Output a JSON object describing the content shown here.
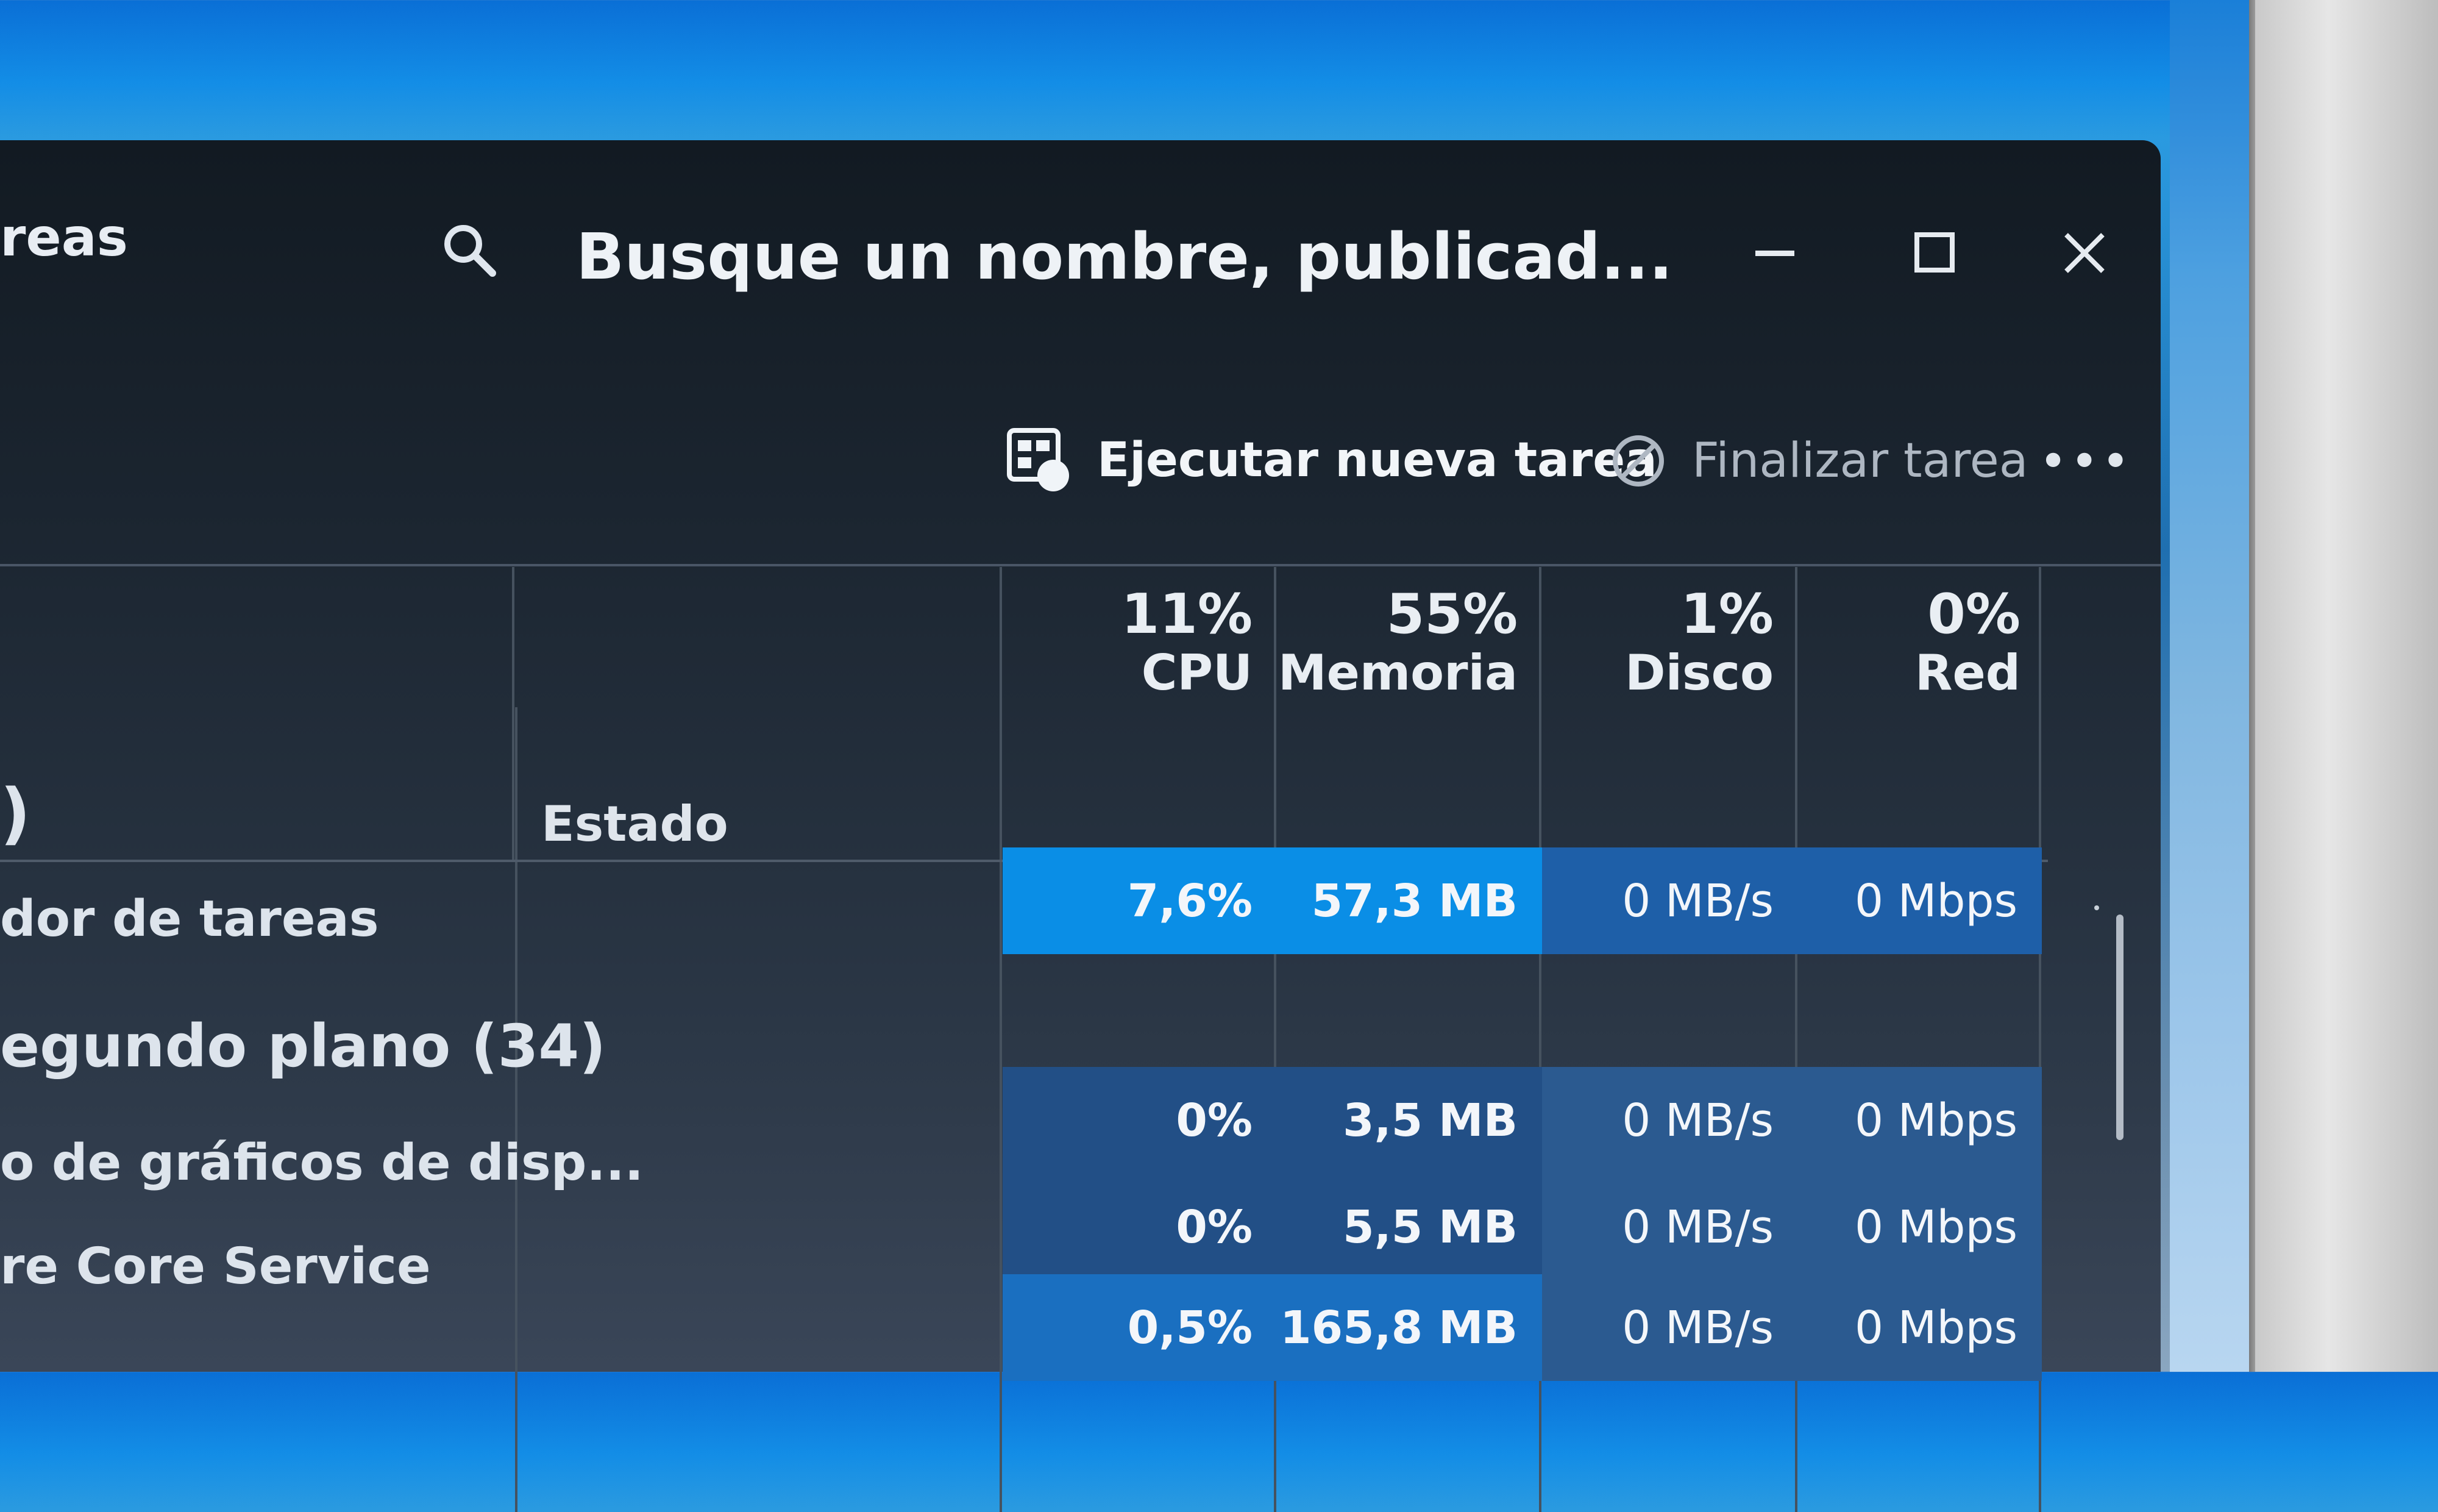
{
  "window": {
    "title_partial": "reas",
    "search_text": "Busque un nombre, publicad..."
  },
  "toolbar": {
    "run_new_task": "Ejecutar nueva tarea",
    "end_task": "Finalizar tarea",
    "more": "•••"
  },
  "columns": {
    "status": "Estado",
    "cpu": {
      "percent": "11%",
      "label": "CPU"
    },
    "memory": {
      "percent": "55%",
      "label": "Memoria"
    },
    "disk": {
      "percent": "1%",
      "label": "Disco"
    },
    "network": {
      "percent": "0%",
      "label": "Red"
    }
  },
  "process_names": [
    ")",
    "dor de tareas",
    "egundo plano (34)",
    "o de gráficos de disp...",
    "re Core Service"
  ],
  "rows": [
    {
      "cpu": "7,6%",
      "memory": "57,3 MB",
      "disk": "0 MB/s",
      "network": "0 Mbps"
    },
    {
      "cpu": "0%",
      "memory": "3,5 MB",
      "disk": "0 MB/s",
      "network": "0 Mbps"
    },
    {
      "cpu": "0%",
      "memory": "5,5 MB",
      "disk": "0 MB/s",
      "network": "0 Mbps"
    },
    {
      "cpu": "0,5%",
      "memory": "165,8 MB",
      "disk": "0 MB/s",
      "network": "0 Mbps"
    }
  ],
  "colors": {
    "heat_high": "#0a8ee6",
    "heat_mid": "#1e5fa8",
    "heat_low": "#224f86"
  },
  "icons": [
    "search-icon",
    "minimize-icon",
    "maximize-icon",
    "close-icon",
    "run-task-icon",
    "end-task-icon",
    "more-icon"
  ]
}
